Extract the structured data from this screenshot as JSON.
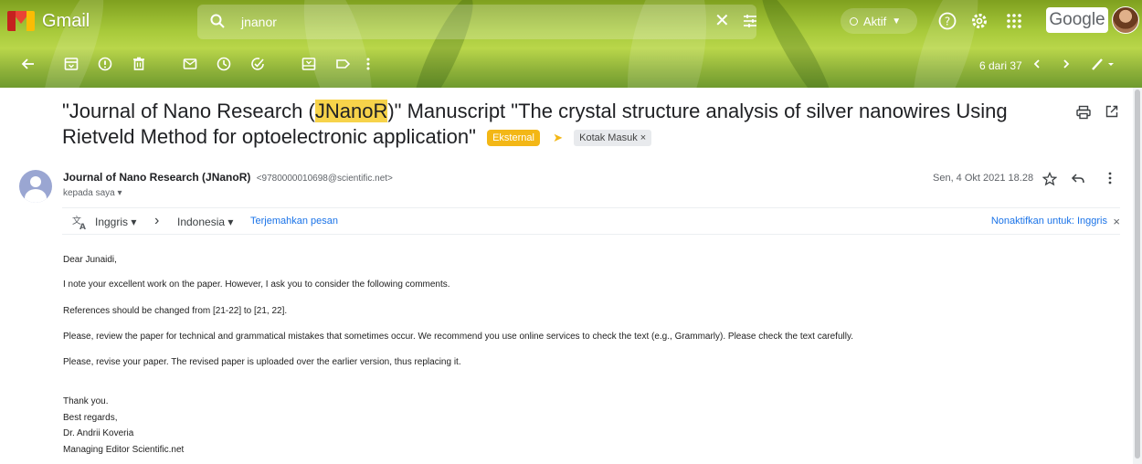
{
  "app": {
    "name": "Gmail",
    "brand_word": "Google"
  },
  "search": {
    "query": "jnanor"
  },
  "status": {
    "label": "Aktif"
  },
  "pager": {
    "text": "6 dari 37"
  },
  "email": {
    "subject_prefix": "\"Journal of Nano Research (",
    "subject_highlight": "JNanoR",
    "subject_suffix": ")\" Manuscript \"The crystal structure analysis of silver nanowires Using Rietveld Method for optoelectronic application\"",
    "labels": {
      "external": "Eksternal",
      "inbox": "Kotak Masuk ×"
    },
    "sender_name": "Journal of Nano Research (JNanoR)",
    "sender_email": "<9780000010698@scientific.net>",
    "recipient": "kepada saya ▾",
    "date": "Sen, 4 Okt 2021 18.28"
  },
  "translate": {
    "from": "Inggris ▾",
    "arrow": "›",
    "to": "Indonesia ▾",
    "translate_link": "Terjemahkan pesan",
    "disable_link": "Nonaktifkan untuk: Inggris",
    "close": "×"
  },
  "body": {
    "greeting": "Dear  Junaidi,",
    "p1": "I note your excellent work on the paper. However, I ask you to consider the following comments.",
    "p2": "References should be changed from [21-22] to [21, 22].",
    "p3": "Please, review the paper for technical and grammatical mistakes that sometimes occur. We recommend you use online services to check the text (e.g., Grammarly). Please check the text carefully.",
    "p4": "Please, revise your paper. The revised paper is uploaded over the earlier version, thus replacing it.",
    "closing": [
      "Thank you.",
      "Best regards,",
      "Dr. Andrii Koveria",
      "Managing Editor Scientific.net"
    ]
  },
  "colors": {
    "label_external": "#f3b716",
    "link": "#1a73e8",
    "highlight": "#f7d34a"
  }
}
